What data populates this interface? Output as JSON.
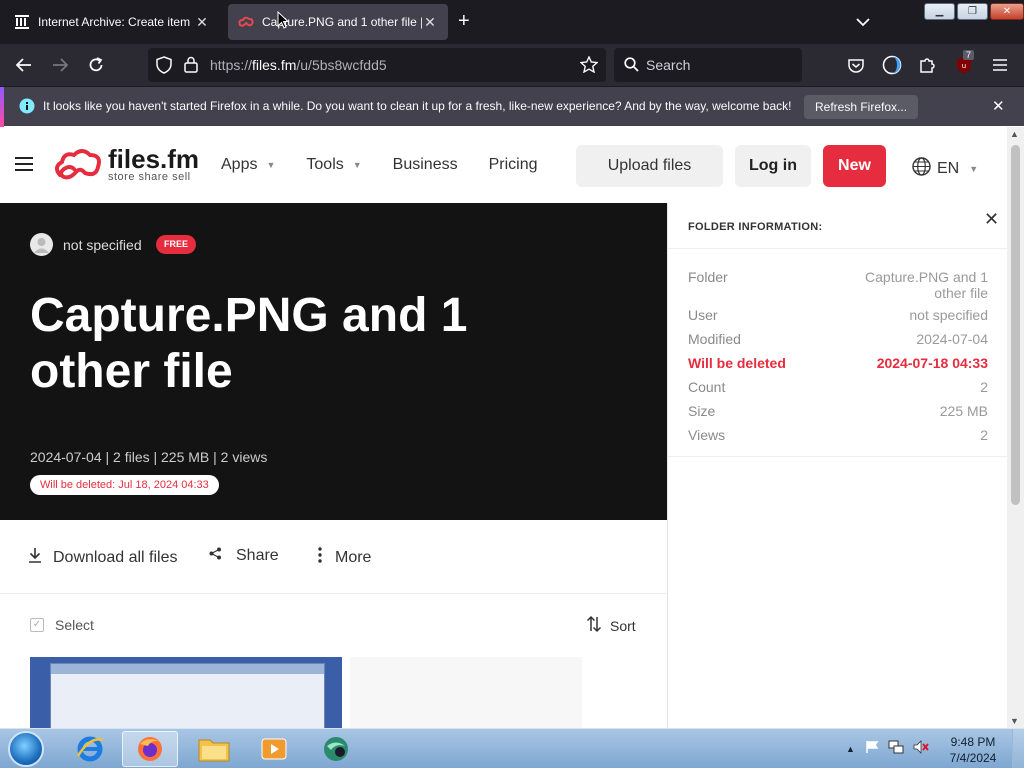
{
  "browser": {
    "tabs": [
      {
        "title": "Internet Archive: Create item",
        "active": false
      },
      {
        "title": "Capture.PNG and 1 other file |",
        "active": true
      }
    ],
    "url_prefix": "https://",
    "url_host": "files.fm",
    "url_path": "/u/5bs8wcfdd5",
    "search_placeholder": "Search",
    "extension_badge": "7",
    "notification": {
      "message": "It looks like you haven't started Firefox in a while. Do you want to clean it up for a fresh, like-new experience? And by the way, welcome back!",
      "button": "Refresh Firefox..."
    }
  },
  "site": {
    "logo": {
      "brand": "files.fm",
      "tagline": "store share sell"
    },
    "menu": [
      {
        "label": "Apps",
        "dropdown": true
      },
      {
        "label": "Tools",
        "dropdown": true
      },
      {
        "label": "Business",
        "dropdown": false
      },
      {
        "label": "Pricing",
        "dropdown": false
      }
    ],
    "upload_label": "Upload files",
    "login_label": "Log in",
    "new_label": "New",
    "language": "EN"
  },
  "hero": {
    "owner": "not specified",
    "plan_badge": "FREE",
    "title": "Capture.PNG and 1 other file",
    "meta": "2024-07-04 | 2 files | 225 MB | 2 views",
    "deletion_notice": "Will be deleted: Jul 18, 2024 04:33"
  },
  "actions": {
    "download_all": "Download all files",
    "share": "Share",
    "more": "More",
    "select": "Select",
    "sort": "Sort"
  },
  "panel": {
    "title": "FOLDER INFORMATION:",
    "rows": [
      {
        "key": "Folder",
        "value": "Capture.PNG and 1 other file"
      },
      {
        "key": "User",
        "value": "not specified"
      },
      {
        "key": "Modified",
        "value": "2024-07-04"
      },
      {
        "key": "Will be deleted",
        "value": "2024-07-18 04:33",
        "warn": true
      },
      {
        "key": "Count",
        "value": "2"
      },
      {
        "key": "Size",
        "value": "225 MB"
      },
      {
        "key": "Views",
        "value": "2"
      }
    ]
  },
  "taskbar": {
    "time": "9:48 PM",
    "date": "7/4/2024"
  },
  "colors": {
    "brand_red": "#e52d3f",
    "firefox_dark": "#1c1b22",
    "hero_bg": "#131313"
  }
}
